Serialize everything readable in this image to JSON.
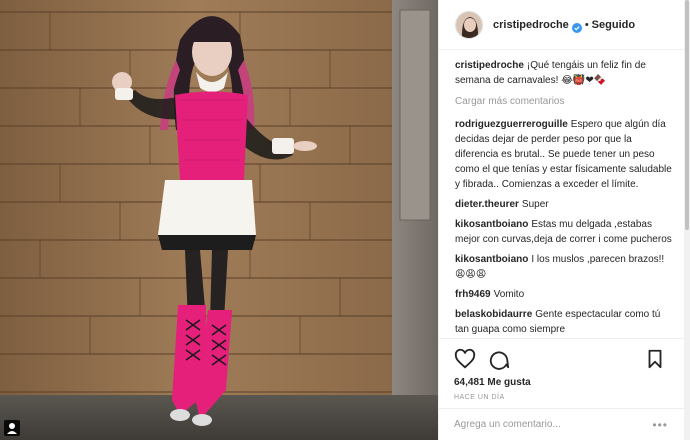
{
  "photo": {
    "alt_icon": "user-tag-icon"
  },
  "header": {
    "username": "cristipedroche",
    "separator": "•",
    "follow_label": "Seguido",
    "verified_icon": "verified-badge-icon"
  },
  "caption": {
    "user": "cristipedroche",
    "text": "¡Qué tengáis un feliz fin de semana de carnavales!",
    "emojis": "😂👹❤🍫"
  },
  "load_more": "Cargar más comentarios",
  "comments": [
    {
      "user": "rodriguezguerreroguille",
      "text": "Espero que algún día decidas dejar de perder peso por que la diferencia es brutal.. Se puede tener un peso como el que tenías y estar físicamente saludable y fibrada.. Comienzas a exceder el límite."
    },
    {
      "user": "dieter.theurer",
      "text": "Super"
    },
    {
      "user": "kikosantboiano",
      "text": "Estas mu delgada ,estabas mejor con curvas,deja de correr i come pucheros"
    },
    {
      "user": "kikosantboiano",
      "text": "I los muslos ,parecen brazos!!",
      "emojis": "😩😩😩"
    },
    {
      "user": "frh9469",
      "text": "Vomito"
    },
    {
      "user": "belaskobidaurre",
      "text": "Gente espectacular como tú tan guapa como siempre"
    }
  ],
  "actions": {
    "likes": "64,481 Me gusta",
    "time": "HACE UN DÍA"
  },
  "add_comment": {
    "placeholder": "Agrega un comentario...",
    "more": "•••"
  },
  "colors": {
    "verified": "#3897f0",
    "pink": "#e5207a",
    "wood": "#9b7651"
  }
}
